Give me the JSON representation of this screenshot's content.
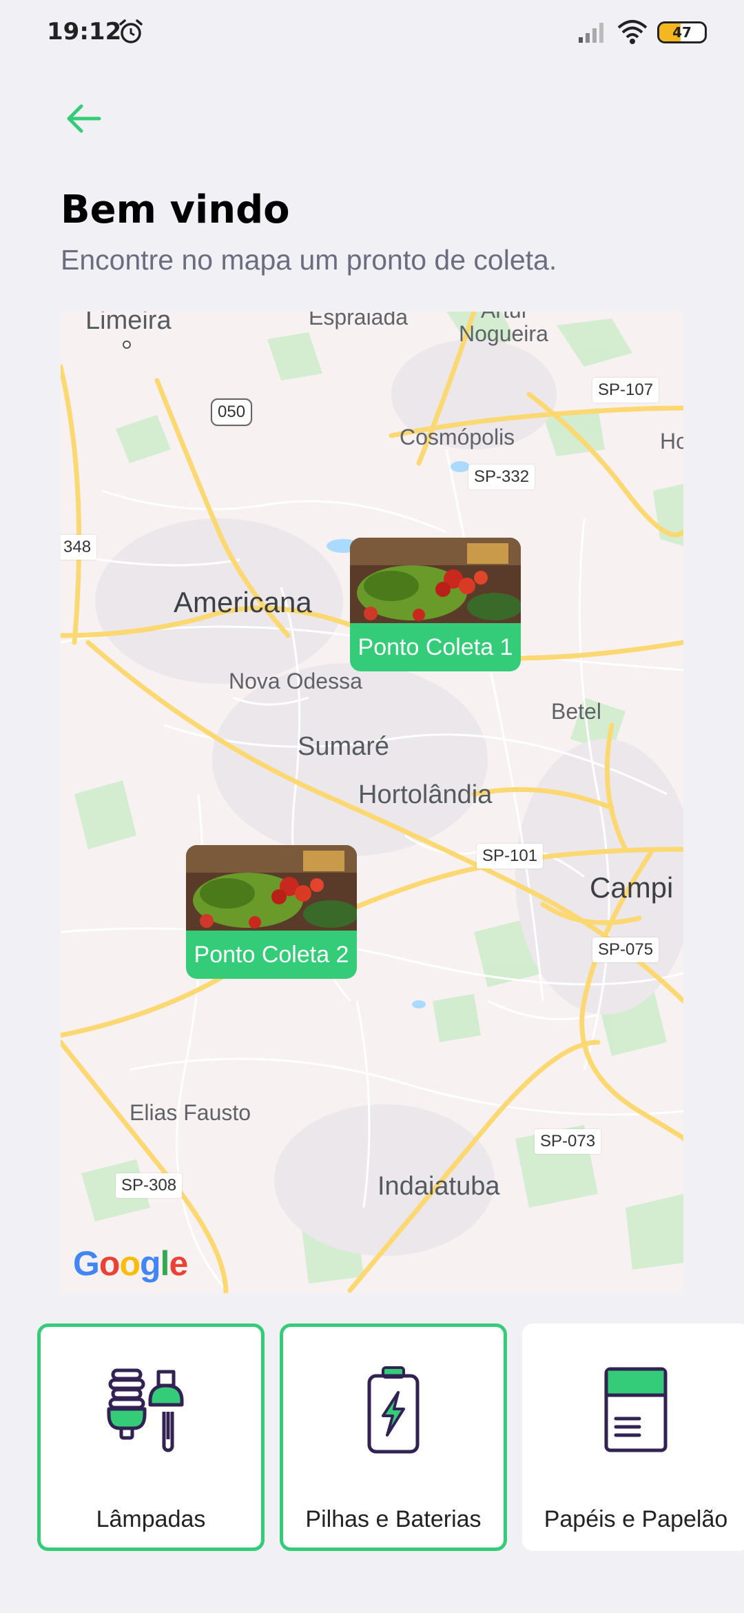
{
  "status_bar": {
    "time": "19:12",
    "battery_level": "47",
    "battery_fraction": 0.47,
    "icons": [
      "alarm-icon",
      "signal-icon",
      "wifi-icon",
      "battery-icon"
    ]
  },
  "header": {
    "back_icon": "arrow-left-icon",
    "title": "Bem vindo",
    "subtitle": "Encontre no mapa um pronto de coleta."
  },
  "map": {
    "places": {
      "limeira": "Limeira",
      "espraiada": "Espraiada",
      "artur": "Artur",
      "nogueira": "Nogueira",
      "cosmopolis": "Cosmópolis",
      "holambra": "Holar",
      "americana": "Americana",
      "nova_odessa": "Nova Odessa",
      "betel": "Betel",
      "sumare": "Sumaré",
      "hortolandia": "Hortolândia",
      "campinas": "Campi",
      "elias_fausto": "Elias Fausto",
      "indaiatuba": "Indaiatuba"
    },
    "roads": {
      "r050": "050",
      "sp107": "SP-107",
      "sp332": "SP-332",
      "sp348": "348",
      "sp101": "SP-101",
      "sp075": "SP-075",
      "sp073": "SP-073",
      "sp308": "SP-308"
    },
    "markers": [
      {
        "label": "Ponto Coleta 1"
      },
      {
        "label": "Ponto Coleta 2"
      }
    ],
    "attribution": "Google"
  },
  "items": [
    {
      "title": "Lâmpadas",
      "icon": "lamps-icon",
      "selected": true
    },
    {
      "title": "Pilhas e Baterias",
      "icon": "battery-icon",
      "selected": true
    },
    {
      "title": "Papéis e Papelão",
      "icon": "paper-icon",
      "selected": false
    }
  ],
  "colors": {
    "accent": "#34cb79",
    "background": "#f0f0f5",
    "title": "#000000",
    "subtitle": "#6c6c80"
  }
}
